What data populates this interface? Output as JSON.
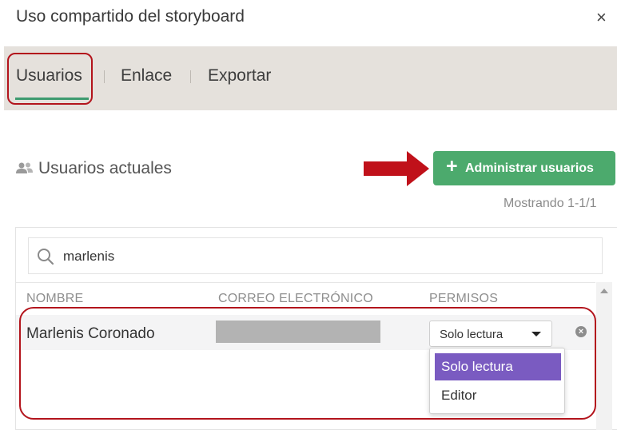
{
  "dialog": {
    "title": "Uso compartido del storyboard",
    "close_icon": "×"
  },
  "tabs": [
    {
      "label": "Usuarios",
      "active": true
    },
    {
      "label": "Enlace",
      "active": false
    },
    {
      "label": "Exportar",
      "active": false
    }
  ],
  "section": {
    "label": "Usuarios actuales",
    "icon": "users-icon"
  },
  "manage_button": {
    "icon": "+",
    "label": "Administrar usuarios",
    "color": "#4caa6d"
  },
  "showing_text": "Mostrando 1-1/1",
  "search": {
    "value": "marlenis",
    "icon": "search-icon"
  },
  "table": {
    "columns": [
      "NOMBRE",
      "CORREO ELECTRÓNICO",
      "PERMISOS"
    ],
    "rows": [
      {
        "name": "Marlenis Coronado",
        "email": "",
        "permission": "Solo lectura"
      }
    ]
  },
  "permission_dropdown": {
    "options": [
      "Solo lectura",
      "Editor"
    ],
    "selected": "Solo lectura",
    "highlight_color": "#7a5bc1"
  },
  "colors": {
    "accent_green": "#3e9b70",
    "annotation_red": "#b3141c",
    "tab_bar_bg": "#e5e1dc"
  }
}
